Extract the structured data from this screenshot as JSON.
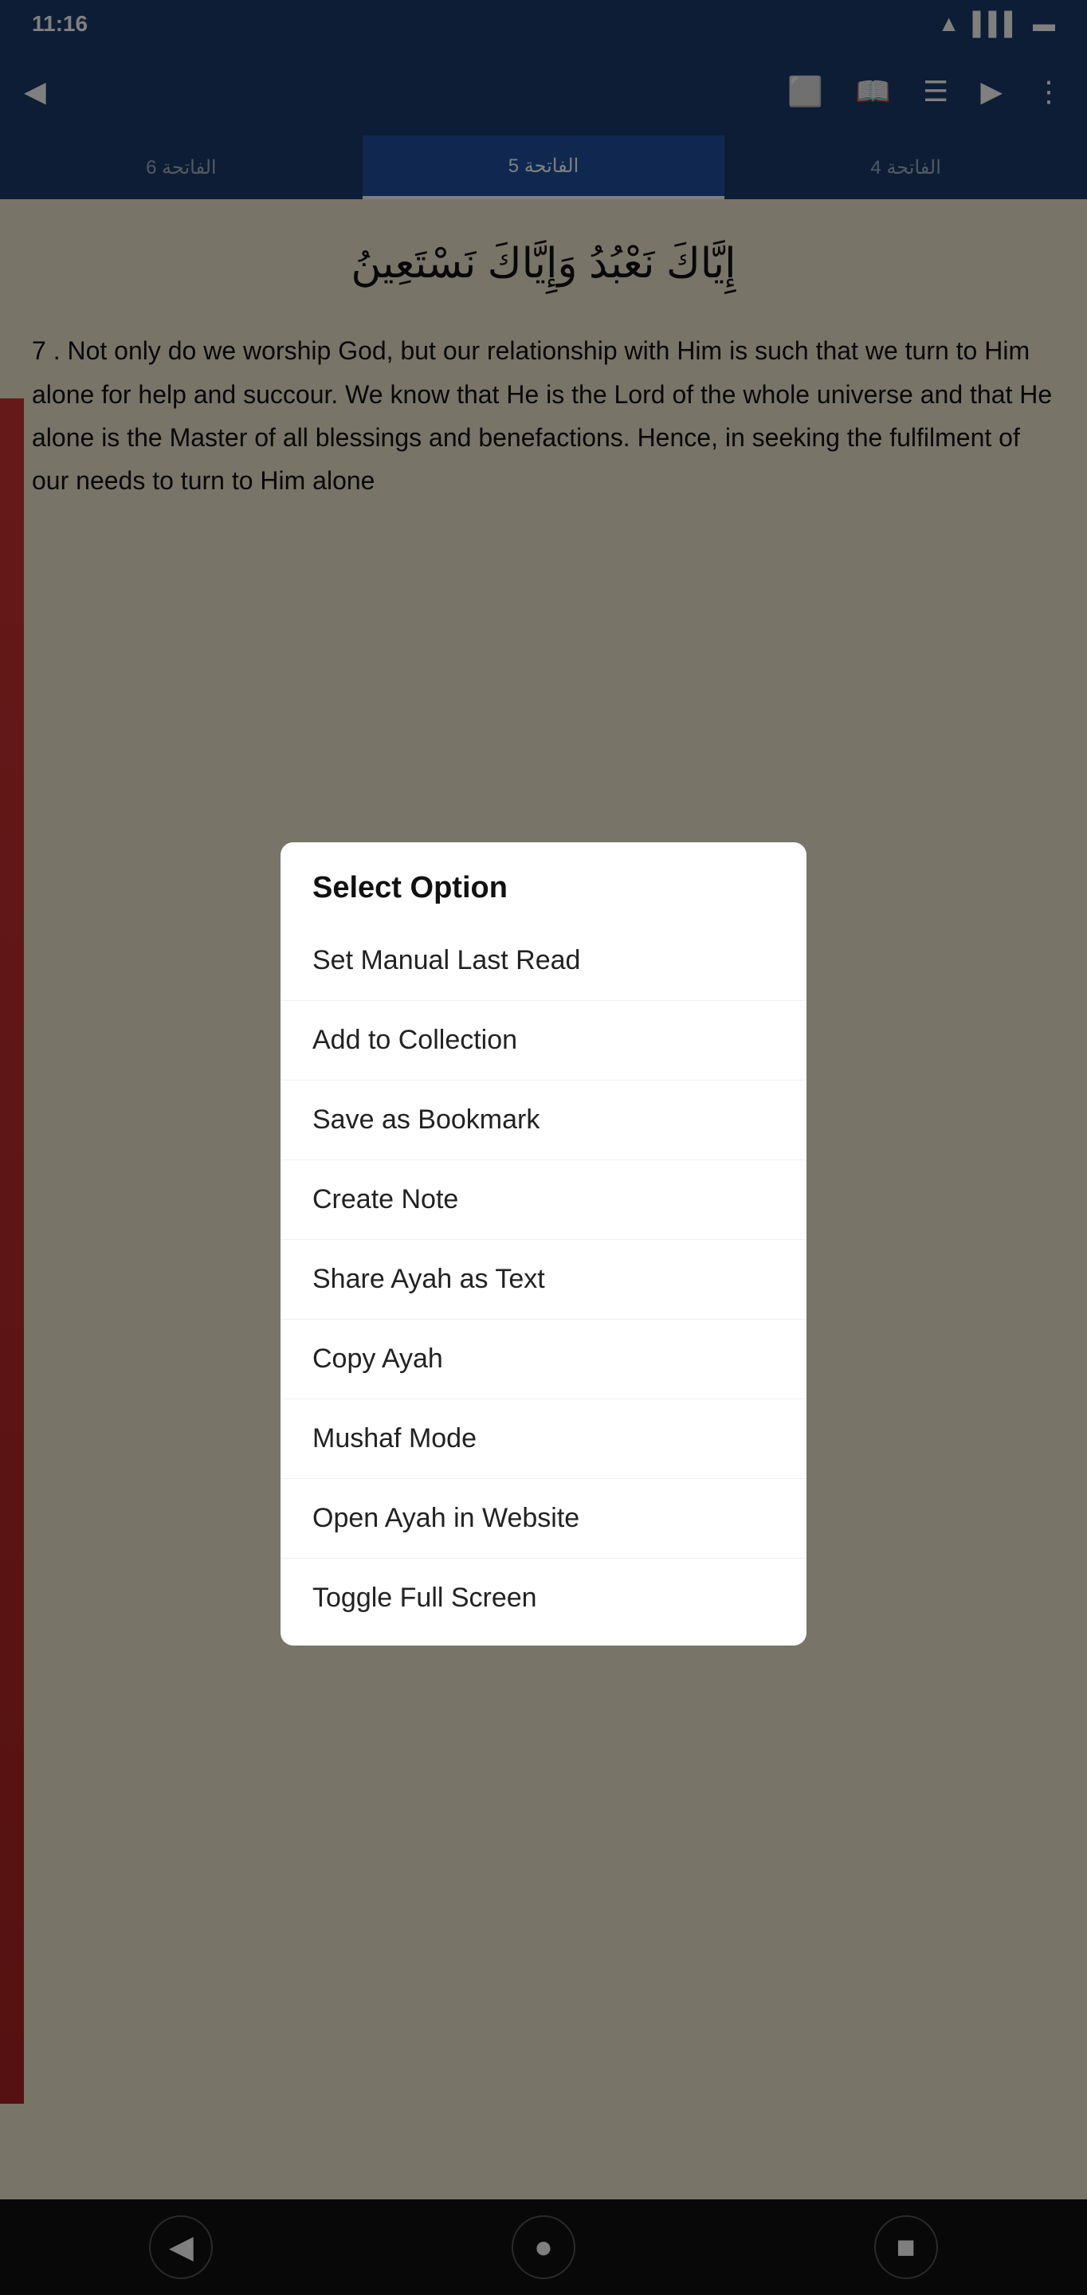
{
  "statusBar": {
    "time": "11:16",
    "icons": [
      "wifi",
      "signal",
      "battery"
    ]
  },
  "navBar": {
    "backIcon": "◀",
    "icons": [
      "open-external",
      "book",
      "list",
      "play",
      "more"
    ]
  },
  "tabBar": {
    "tabs": [
      {
        "label": "الفاتحة 6",
        "active": false
      },
      {
        "label": "5 الفاتحة",
        "active": true
      },
      {
        "label": "4 الفاتحة",
        "active": false
      }
    ]
  },
  "arabicText": "إِيَّاكَ نَعْبُدُ وَإِيَّاكَ نَسْتَعِينُ",
  "bodyText": "7 . Not only do we worship God, but our relationship with Him is such that we turn to Him alone for help and succour. We know that He is the Lord of the whole universe and that He alone is the Master of all blessings and benefactions. Hence, in seeking the fulfilment of our needs to turn to Him alone",
  "modal": {
    "title": "Select Option",
    "items": [
      {
        "id": "set-manual-last-read",
        "label": "Set Manual Last Read"
      },
      {
        "id": "add-to-collection",
        "label": "Add to Collection"
      },
      {
        "id": "save-as-bookmark",
        "label": "Save as Bookmark"
      },
      {
        "id": "create-note",
        "label": "Create Note"
      },
      {
        "id": "share-ayah-as-text",
        "label": "Share Ayah as Text"
      },
      {
        "id": "copy-ayah",
        "label": "Copy Ayah"
      },
      {
        "id": "mushaf-mode",
        "label": "Mushaf Mode"
      },
      {
        "id": "open-ayah-in-website",
        "label": "Open Ayah in Website"
      },
      {
        "id": "toggle-full-screen",
        "label": "Toggle Full Screen"
      }
    ]
  },
  "bottomNav": {
    "buttons": [
      "back-arrow",
      "home-circle",
      "square-recent"
    ]
  }
}
